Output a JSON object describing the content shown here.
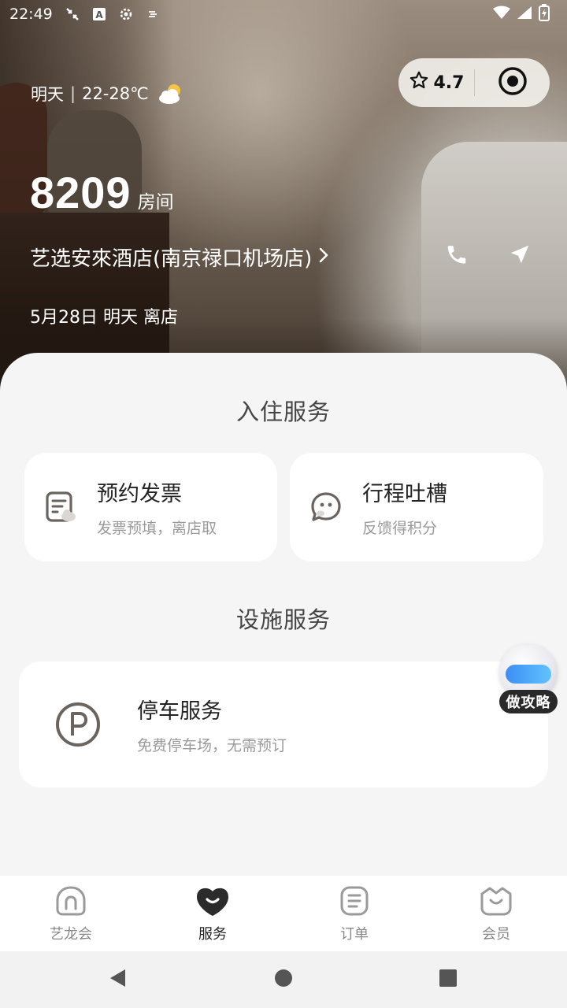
{
  "status_bar": {
    "time": "22:49"
  },
  "hero": {
    "weather": {
      "day": "明天",
      "temp": "22-28℃"
    },
    "rating": "4.7",
    "room": {
      "number": "8209",
      "unit": "房间"
    },
    "hotel_name": "艺选安來酒店(南京禄口机场店)",
    "checkout": "5月28日 明天  离店"
  },
  "checkin_services": {
    "title": "入住服务",
    "items": [
      {
        "title": "预约发票",
        "subtitle": "发票预填，离店取",
        "icon": "invoice-icon"
      },
      {
        "title": "行程吐槽",
        "subtitle": "反馈得积分",
        "icon": "feedback-icon"
      }
    ]
  },
  "facility_services": {
    "title": "设施服务",
    "items": [
      {
        "title": "停车服务",
        "subtitle": "免费停车场，无需预订",
        "icon": "parking-icon"
      }
    ]
  },
  "assistant": {
    "label": "做攻略"
  },
  "tabbar": {
    "tabs": [
      {
        "label": "艺龙会",
        "icon": "home-icon",
        "active": false
      },
      {
        "label": "服务",
        "icon": "service-heart-icon",
        "active": true
      },
      {
        "label": "订单",
        "icon": "order-icon",
        "active": false
      },
      {
        "label": "会员",
        "icon": "member-icon",
        "active": false
      }
    ]
  }
}
